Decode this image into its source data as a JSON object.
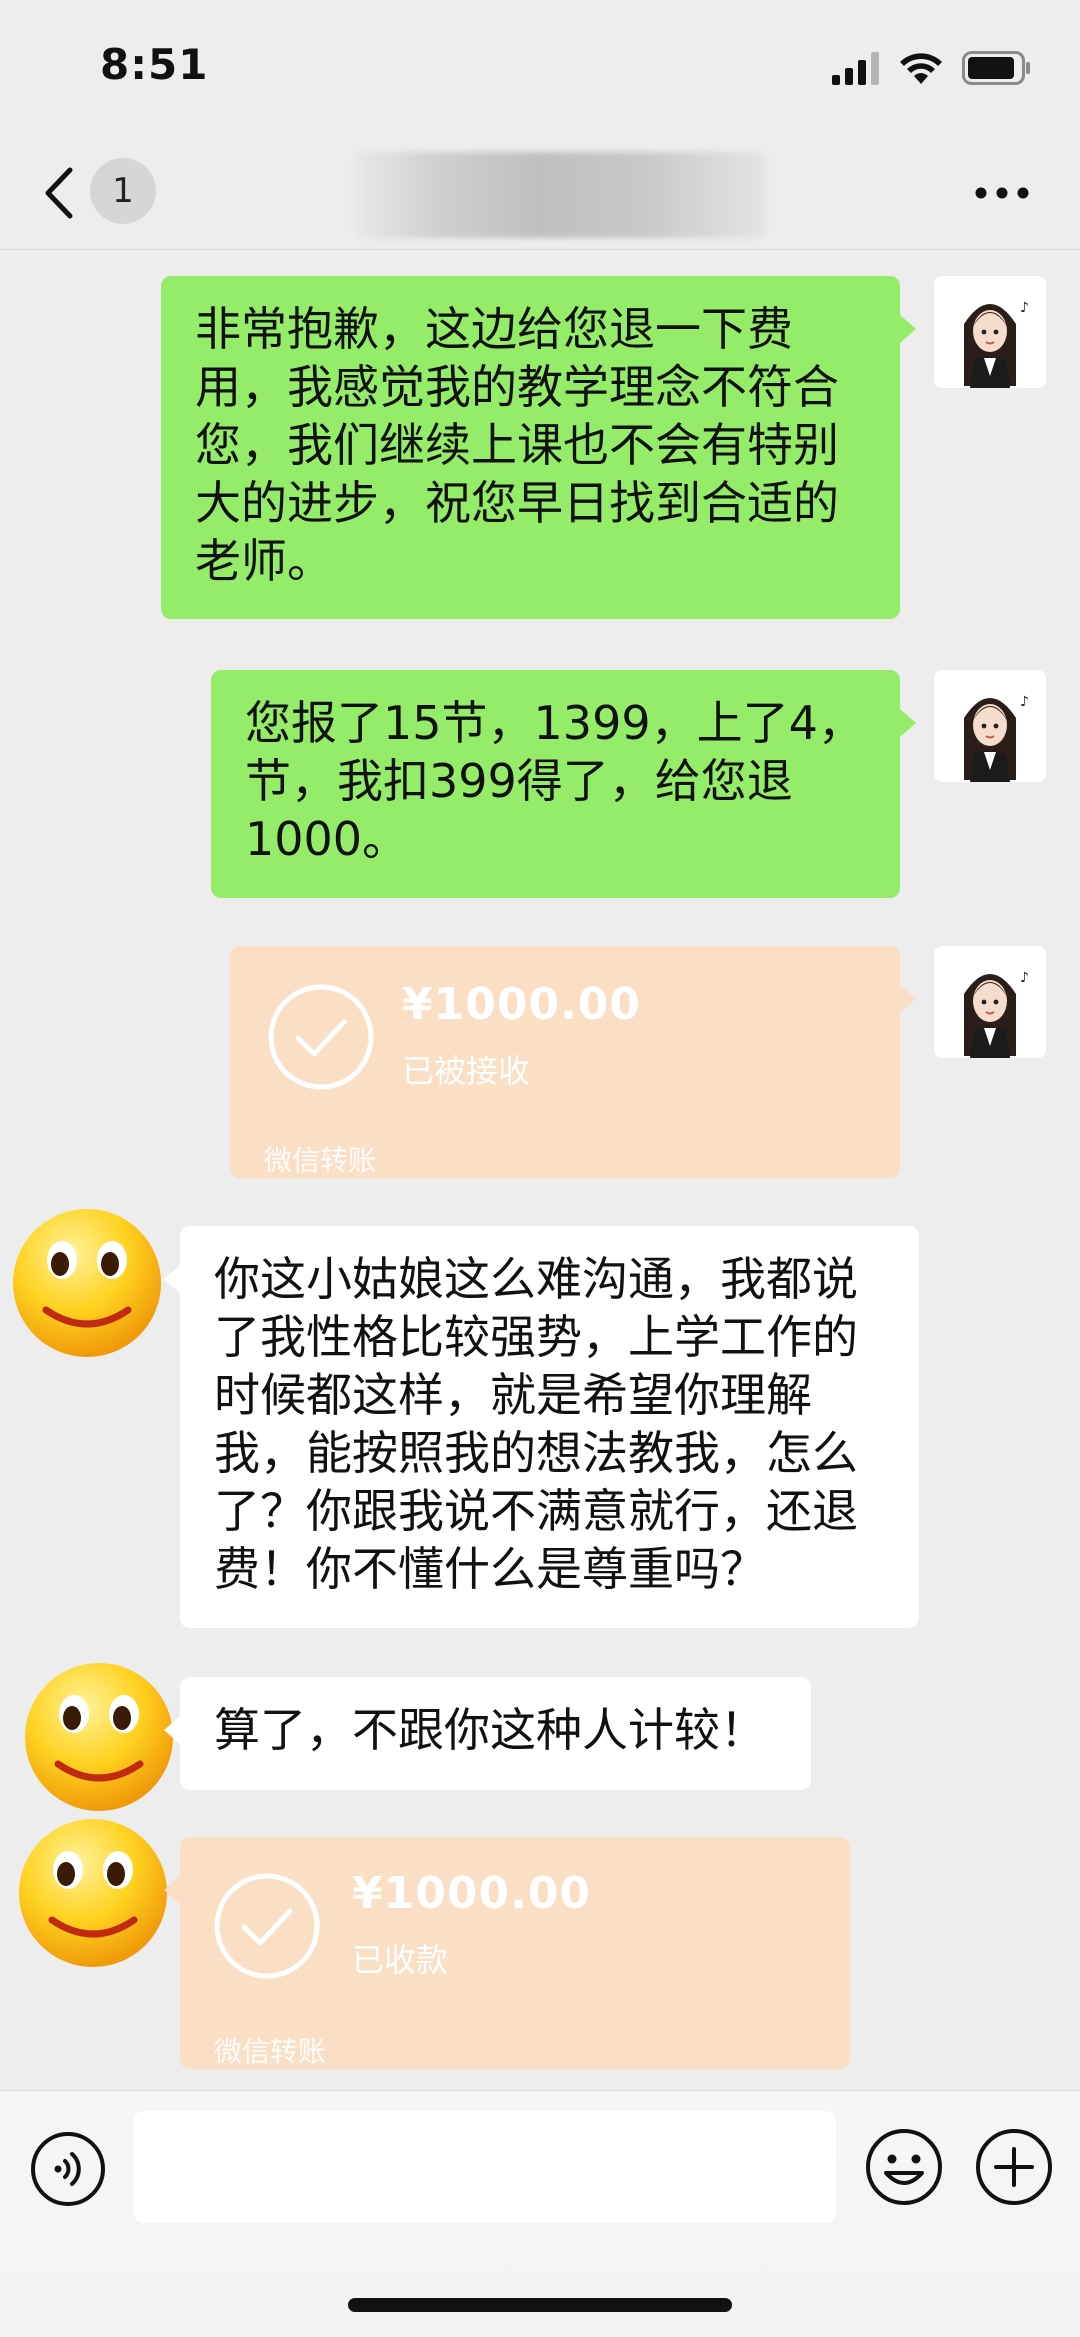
{
  "status_bar": {
    "time": "8:51",
    "battery_level": 0.9
  },
  "nav": {
    "unread_count": "1"
  },
  "messages": [
    {
      "side": "right",
      "type": "text",
      "text": "非常抱歉，这边给您退一下费用，我感觉我的教学理念不符合您，我们继续上课也不会有特别大的进步，祝您早日找到合适的老师。"
    },
    {
      "side": "right",
      "type": "text",
      "text": "您报了15节，1399，上了4，节，我扣399得了，给您退1000。"
    },
    {
      "side": "right",
      "type": "transfer",
      "amount": "¥1000.00",
      "status": "已被接收",
      "footer": "微信转账"
    },
    {
      "side": "left",
      "type": "text",
      "text": "你这小姑娘这么难沟通，我都说了我性格比较强势，上学工作的时候都这样，就是希望你理解我，能按照我的想法教我，怎么了？你跟我说不满意就行，还退费！你不懂什么是尊重吗？"
    },
    {
      "side": "left",
      "type": "text",
      "text": "算了，不跟你这种人计较！"
    },
    {
      "side": "left",
      "type": "transfer",
      "amount": "¥1000.00",
      "status": "已收款",
      "footer": "微信转账"
    }
  ],
  "input": {
    "placeholder": ""
  },
  "colors": {
    "background": "#ededed",
    "sent_bubble": "#95ec69",
    "received_bubble": "#ffffff",
    "transfer_bubble": "#fbdfc4"
  }
}
